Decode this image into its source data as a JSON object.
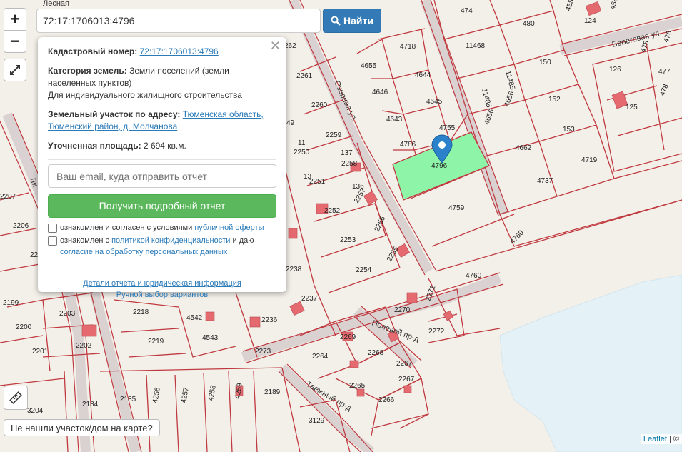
{
  "search": {
    "value": "72:17:1706013:4796",
    "button_label": "Найти"
  },
  "zoom": {
    "in": "+",
    "out": "−"
  },
  "popup": {
    "cadastral_label": "Кадастровый номер:",
    "cadastral_value": "72:17:1706013:4796",
    "category_label": "Категория земель:",
    "category_value": "Земли поселений (земли населенных пунктов)",
    "usage": "Для индивидуального жилищного строительства",
    "address_label": "Земельный участок по адресу:",
    "address_value": "Тюменская область, Тюменский район, д. Молчанова",
    "area_label": "Уточненная площадь:",
    "area_value": "2 694 кв.м.",
    "email_placeholder": "Ваш email, куда отправить отчет",
    "report_button": "Получить подробный отчет",
    "agree1_text": "ознакомлен и согласен с условиями ",
    "agree1_link": "публичной оферты",
    "agree2_text": "ознакомлен с ",
    "agree2_link": "политикой конфиденциальности",
    "agree2_mid": " и даю ",
    "agree2_link2": "согласие на обработку персональных данных",
    "details_link": "Детали отчета и юридическая информация",
    "manual_link": "Ручной выбор вариантов"
  },
  "not_found_button": "Не нашли участок/дом на карте?",
  "attribution": {
    "link": "Leaflet",
    "suffix": " | ©"
  },
  "colors": {
    "boundary": "#c0393f",
    "selected": "#8ef5a8",
    "marker": "#2b82cb",
    "road": "#c9c0c2"
  },
  "map": {
    "streets": [
      "Лесная",
      "Озерная ул.",
      "Береговая ул.",
      "Полевой пр-д",
      "Таежный пр-д",
      "Ли"
    ],
    "plots": [
      "474",
      "480",
      "458",
      "124",
      "454",
      "11468",
      "4718",
      "4655",
      "4644",
      "4646",
      "4645",
      "4643",
      "4755",
      "4786",
      "4796",
      "4759",
      "150",
      "11485",
      "11485",
      "4656",
      "4656",
      "152",
      "153",
      "4662",
      "4719",
      "4737",
      "4760",
      "126",
      "477",
      "125",
      "478",
      "475",
      "476",
      "262",
      "2261",
      "2260",
      "2259",
      "49",
      "11",
      "2250",
      "137",
      "2258",
      "13",
      "2251",
      "136",
      "2257",
      "2252",
      "2256",
      "2253",
      "2255",
      "2254",
      "2238",
      "2237",
      "2236",
      "2207",
      "2206",
      "22",
      "2199",
      "2203",
      "2200",
      "2201",
      "2202",
      "2218",
      "2219",
      "4542",
      "4543",
      "2273",
      "2271",
      "2270",
      "2272",
      "2269",
      "2268",
      "2264",
      "2267",
      "2266",
      "2265",
      "2267",
      "4760",
      "2189",
      "2185",
      "2184",
      "4256",
      "4257",
      "4258",
      "4259",
      "3204",
      "3129"
    ]
  }
}
